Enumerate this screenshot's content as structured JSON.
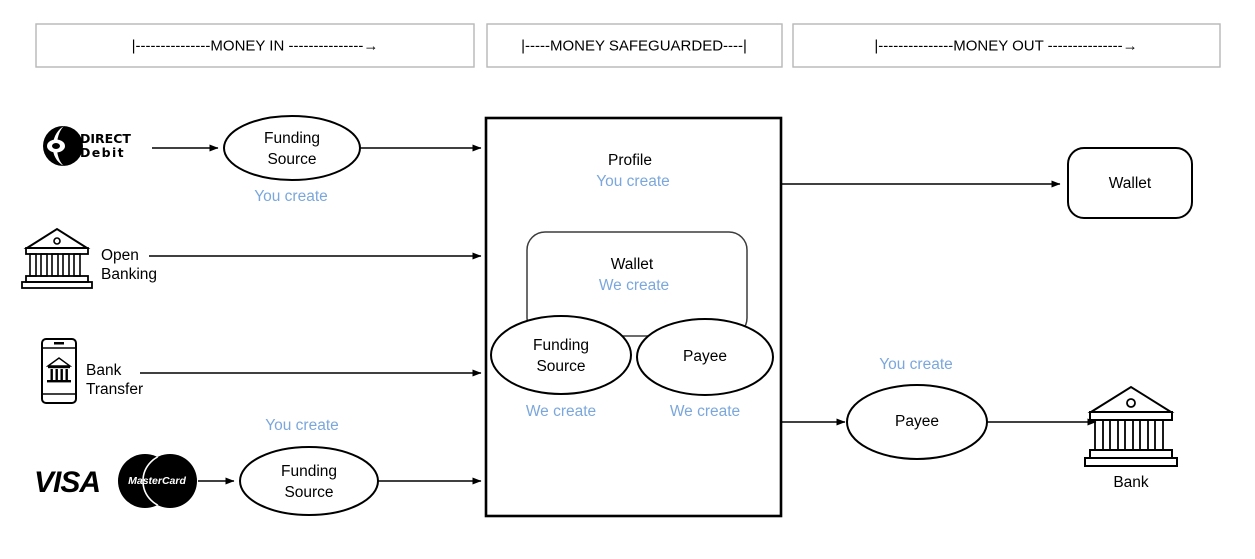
{
  "page": {
    "title": "Money flow diagram",
    "background": "#ffffff",
    "accent_blue": "#7ba7dc",
    "line_color": "#000000"
  },
  "headers": [
    {
      "id": "money-in",
      "label": "|---------------MONEY IN ---------------→"
    },
    {
      "id": "money-safeguarded",
      "label": "|-----MONEY SAFEGUARDED----|"
    },
    {
      "id": "money-out",
      "label": "|---------------MONEY OUT ---------------→"
    }
  ],
  "sources": [
    {
      "id": "direct-debit",
      "icon": "direct-debit-logo",
      "logo_line1": "DIRECT",
      "logo_line2": "Debit",
      "label": "",
      "node": {
        "label_line1": "Funding",
        "label_line2": "Source",
        "note": "You create"
      }
    },
    {
      "id": "open-banking",
      "icon": "bank-building-icon",
      "label_line1": "Open",
      "label_line2": "Banking"
    },
    {
      "id": "bank-transfer",
      "icon": "mobile-bank-icon",
      "label_line1": "Bank",
      "label_line2": "Transfer"
    },
    {
      "id": "cards",
      "icon_visa": "visa-logo",
      "icon_mastercard": "mastercard-logo",
      "visa_text": "VISA",
      "mastercard_text": "MasterCard",
      "node": {
        "label_line1": "Funding",
        "label_line2": "Source",
        "note": "You create"
      }
    }
  ],
  "safeguarded": {
    "profile": {
      "label": "Profile",
      "note": "You create"
    },
    "wallet": {
      "label": "Wallet",
      "note": "We create"
    },
    "funding_source": {
      "label_line1": "Funding",
      "label_line2": "Source",
      "note": "We create"
    },
    "payee": {
      "label": "Payee",
      "note": "We create"
    }
  },
  "outputs": {
    "wallet": {
      "label": "Wallet"
    },
    "payee": {
      "label": "Payee",
      "note": "You create"
    },
    "bank": {
      "label": "Bank",
      "icon": "bank-building-icon"
    }
  }
}
